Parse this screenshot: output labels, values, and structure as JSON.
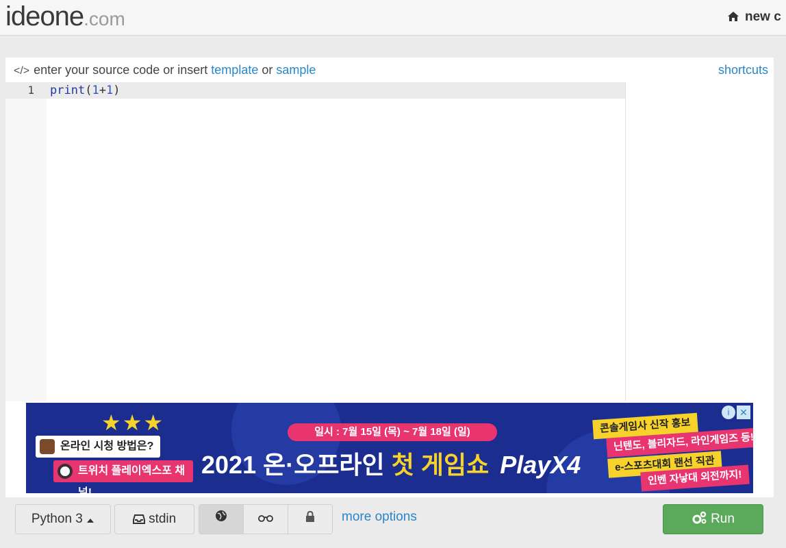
{
  "header": {
    "logo_main": "ideone",
    "logo_tld": ".com",
    "nav_label": "new c"
  },
  "editor": {
    "hint_prefix": "enter your source code or insert",
    "template_link": "template",
    "hint_or": "or",
    "sample_link": "sample",
    "shortcuts_link": "shortcuts",
    "line_number": "1",
    "code": {
      "fn": "print",
      "open": "(",
      "a": "1",
      "op": "+",
      "b": "1",
      "close": ")"
    }
  },
  "ad": {
    "stars": "★★★",
    "question": "온라인 시청 방법은?",
    "twitch": "트위치 플레이엑스포 채널!",
    "date": "일시 : 7월 15일 (목) ~ 7월 18일 (일)",
    "title_a": "2021 온·오프라인",
    "title_hl": "첫 게임쇼",
    "brand": "PlayX4",
    "tag1": "콘솔게임사 신작 홍보",
    "tag2": "닌텐도, 블리자드, 라인게임즈 등!",
    "tag3": "e-스포츠대회 랜선 직관",
    "tag4": "인벤 자낳대 외전까지!"
  },
  "toolbar": {
    "language": "Python 3",
    "stdin": "stdin",
    "more_options": "more options",
    "run": "Run"
  },
  "colors": {
    "link": "#2a86c6",
    "run_button": "#5ba95b",
    "ad_background": "#1b2e8f"
  }
}
